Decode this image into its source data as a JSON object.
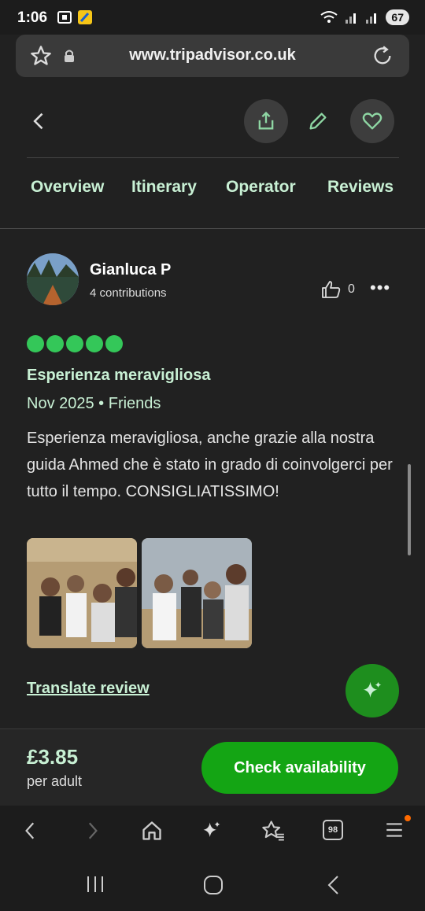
{
  "status": {
    "time": "1:06",
    "battery": "67"
  },
  "browser": {
    "url": "www.tripadvisor.co.uk"
  },
  "tabs": [
    "Overview",
    "Itinerary",
    "Operator",
    "Reviews"
  ],
  "review": {
    "author": "Gianluca P",
    "contributions": "4 contributions",
    "helpful_count": "0",
    "rating": 5,
    "title": "Esperienza meravigliosa",
    "meta": "Nov 2025 • Friends",
    "body": "Esperienza meravigliosa, anche grazie alla nostra guida Ahmed che è stato in grado di coinvolgerci per tutto il tempo. CONSIGLIATISSIMO!",
    "translate_label": "Translate review"
  },
  "booking": {
    "price": "£3.85",
    "per": "per adult",
    "cta": "Check availability"
  },
  "browser_nav": {
    "tab_count": "98"
  },
  "colors": {
    "accent_green": "#14a514",
    "mint_text": "#c8f0d4",
    "rating_green": "#34c759"
  }
}
